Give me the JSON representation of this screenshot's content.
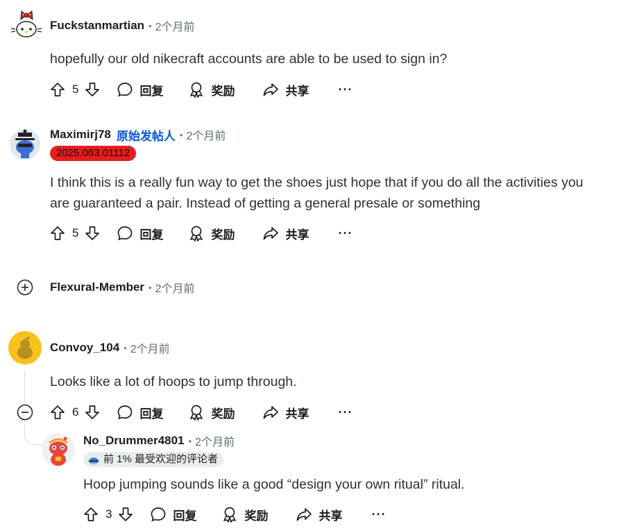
{
  "comments": [
    {
      "author": "Fuckstanmartian",
      "time": "2个月前",
      "body": [
        "hopefully our old nikecraft accounts are able to be used to sign in?"
      ],
      "votes": "5",
      "actions": {
        "reply": "回复",
        "award": "奖励",
        "share": "共享",
        "more": "···"
      }
    },
    {
      "author": "Maximirj78",
      "op_label": "原始发帖人",
      "time": "2个月前",
      "flair": "2025.063.01112",
      "body": [
        "I think this is a really fun way to get the shoes just hope that if you do all the activities you",
        "are guaranteed a pair. Instead of getting a general presale or something"
      ],
      "votes": "5",
      "actions": {
        "reply": "回复",
        "award": "奖励",
        "share": "共享",
        "more": "···"
      }
    },
    {
      "author": "Flexural-Member",
      "time": "2个月前",
      "collapsed": true
    },
    {
      "author": "Convoy_104",
      "time": "2个月前",
      "body": [
        "Looks like a lot of hoops to jump through."
      ],
      "votes": "6",
      "actions": {
        "reply": "回复",
        "award": "奖励",
        "share": "共享",
        "more": "···"
      }
    },
    {
      "author": "No_Drummer4801",
      "time": "2个月前",
      "badge": "前 1% 最受欢迎的评论者",
      "body": [
        "Hoop jumping sounds like a good “design your own ritual” ritual."
      ],
      "votes": "3",
      "actions": {
        "reply": "回复",
        "award": "奖励",
        "share": "共享",
        "more": "···"
      }
    }
  ],
  "colors": {
    "op": "#0a57d0",
    "flair_bg": "#e41f1f",
    "avatar_yellow": "#f6c21c",
    "snoo_red": "#e8463a"
  },
  "icons": [
    "upvote-icon",
    "downvote-icon",
    "comment-icon",
    "award-icon",
    "share-icon",
    "expand-icon",
    "collapse-icon"
  ]
}
